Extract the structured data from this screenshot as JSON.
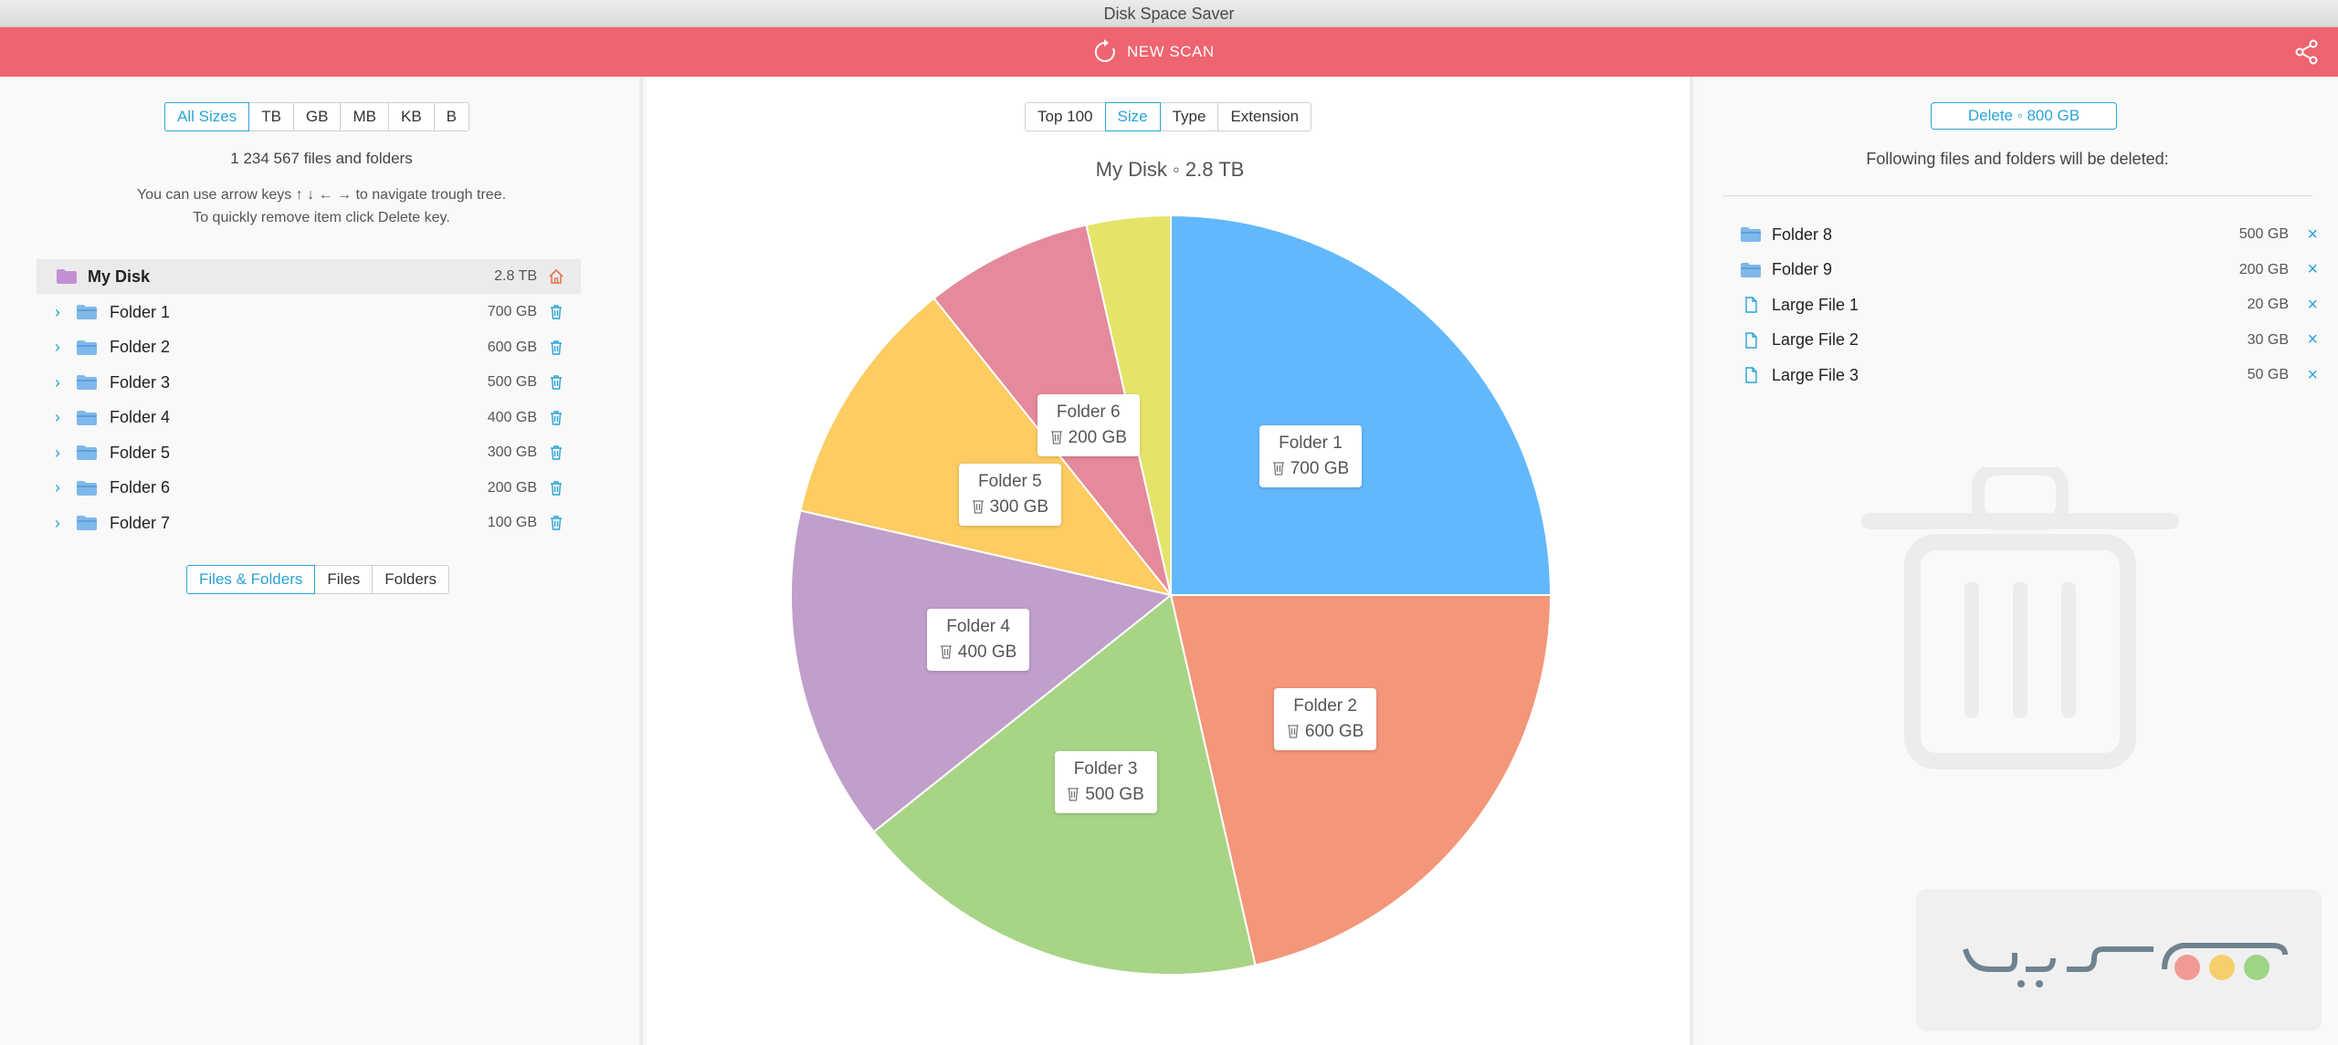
{
  "app": {
    "title": "Disk Space Saver"
  },
  "toolbar": {
    "new_scan_label": "NEW SCAN",
    "accent": "#ee6470"
  },
  "left": {
    "size_filter": [
      "All Sizes",
      "TB",
      "GB",
      "MB",
      "KB",
      "B"
    ],
    "size_filter_active": "All Sizes",
    "files_count": "1 234 567 files and folders",
    "hint_line1": "You can use arrow keys ↑ ↓ ← → to navigate trough tree.",
    "hint_line2": "To quickly remove item click Delete key.",
    "root": {
      "name": "My Disk",
      "size": "2.8 TB"
    },
    "items": [
      {
        "name": "Folder 1",
        "size": "700 GB"
      },
      {
        "name": "Folder 2",
        "size": "600 GB"
      },
      {
        "name": "Folder 3",
        "size": "500 GB"
      },
      {
        "name": "Folder 4",
        "size": "400 GB"
      },
      {
        "name": "Folder 5",
        "size": "300 GB"
      },
      {
        "name": "Folder 6",
        "size": "200 GB"
      },
      {
        "name": "Folder 7",
        "size": "100 GB"
      }
    ],
    "type_filter": [
      "Files & Folders",
      "Files",
      "Folders"
    ],
    "type_filter_active": "Files & Folders"
  },
  "center": {
    "view_tabs": [
      "Top 100",
      "Size",
      "Type",
      "Extension"
    ],
    "view_active": "Size",
    "chart_title": "My Disk ◦ 2.8 TB"
  },
  "chart_data": {
    "type": "pie",
    "title": "My Disk ◦ 2.8 TB",
    "unit": "GB",
    "slices": [
      {
        "label": "Folder 1",
        "display": "700 GB",
        "value": 700,
        "color": "#63b8fc"
      },
      {
        "label": "Folder 2",
        "display": "600 GB",
        "value": 600,
        "color": "#f4967a"
      },
      {
        "label": "Folder 3",
        "display": "500 GB",
        "value": 500,
        "color": "#a8d486"
      },
      {
        "label": "Folder 4",
        "display": "400 GB",
        "value": 400,
        "color": "#c09fcb"
      },
      {
        "label": "Folder 5",
        "display": "300 GB",
        "value": 300,
        "color": "#fdcc62"
      },
      {
        "label": "Folder 6",
        "display": "200 GB",
        "value": 200,
        "color": "#e58a9a"
      },
      {
        "label": "Folder 7",
        "display": "",
        "value": 100,
        "color": "#e5e46a"
      }
    ]
  },
  "right": {
    "delete_button": "Delete ◦ 800 GB",
    "note": "Following files and folders will be deleted:",
    "items": [
      {
        "name": "Folder 8",
        "size": "500 GB",
        "kind": "folder"
      },
      {
        "name": "Folder 9",
        "size": "200 GB",
        "kind": "folder"
      },
      {
        "name": "Large File 1",
        "size": "20 GB",
        "kind": "file"
      },
      {
        "name": "Large File 2",
        "size": "30 GB",
        "kind": "file"
      },
      {
        "name": "Large File 3",
        "size": "50 GB",
        "kind": "file"
      }
    ]
  },
  "colors": {
    "accent_blue": "#2aa3d6",
    "toolbar_red": "#ee6470",
    "folder_blue": "#7fb8ea",
    "root_purple": "#c58fd6",
    "trash_orange": "#e8734f"
  }
}
